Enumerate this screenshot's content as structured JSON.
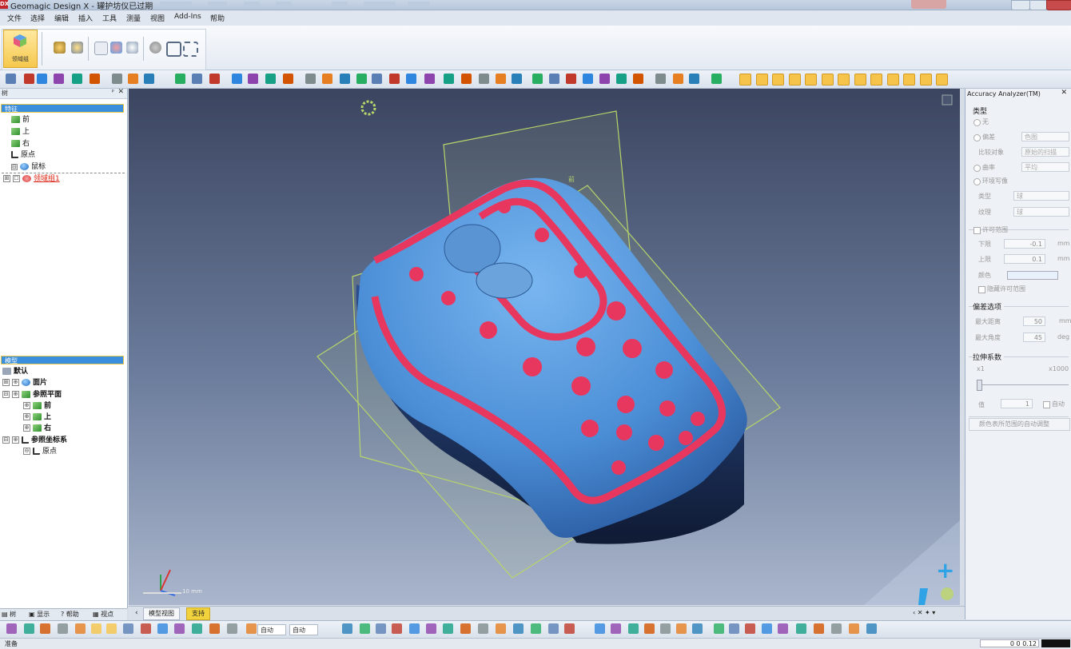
{
  "titlebar": {
    "app_name": "Geomagic Design X - 罐护坊仪已过期",
    "app_icon": "DX"
  },
  "menu": [
    "文件",
    "选择",
    "编辑",
    "插入",
    "工具",
    "测量",
    "视图",
    "Add-Ins",
    "帮助"
  ],
  "ribbon": {
    "region_group_label": "领域组"
  },
  "feature_tree": {
    "panel_title": "树",
    "header": "特征",
    "items": [
      {
        "label": "前",
        "icon": "plane-icon"
      },
      {
        "label": "上",
        "icon": "plane-icon"
      },
      {
        "label": "右",
        "icon": "plane-icon"
      },
      {
        "label": "原点",
        "icon": "axis-icon"
      },
      {
        "label": "鼠标",
        "icon": "mesh-icon"
      },
      {
        "label": "领域组1",
        "icon": "region-group-icon"
      }
    ]
  },
  "model_tree": {
    "header": "模型",
    "items": [
      {
        "label": "默认"
      },
      {
        "label": "面片"
      },
      {
        "label": "参照平面"
      },
      {
        "label": "前"
      },
      {
        "label": "上"
      },
      {
        "label": "右"
      },
      {
        "label": "参照坐标系"
      },
      {
        "label": "原点"
      }
    ]
  },
  "panel_tabs": [
    "树",
    "显示",
    "帮助",
    "视点"
  ],
  "viewport": {
    "plane_label": "前",
    "scale_label": "10 mm",
    "colors": {
      "mesh": "#4d8fd6",
      "band": "#e8375f",
      "plane": "#b8d56a"
    }
  },
  "accuracy_analyzer": {
    "title": "Accuracy Analyzer(TM)",
    "type_section": "类型",
    "opt_none": "无",
    "opt_deviation": "偏差",
    "deviation_value": "色图",
    "compare_label": "比较对象",
    "compare_value": "原始的扫描",
    "opt_curvature": "曲率",
    "curvature_value": "平均",
    "opt_env": "环境写像",
    "kind_label": "类型",
    "kind_value": "球",
    "texture_label": "纹理",
    "texture_value": "球",
    "tolerance_section": "许可范围",
    "lower_label": "下限",
    "lower_value": "-0.1",
    "upper_label": "上限",
    "upper_value": "0.1",
    "unit_mm": "mm",
    "color_label": "颜色",
    "hide_tolerance": "隐藏许可范围",
    "deviation_options": "偏差选项",
    "max_dist_label": "最大距离",
    "max_dist_value": "50",
    "max_angle_label": "最大角度",
    "max_angle_value": "45",
    "unit_deg": "deg",
    "stretch_section": "拉伸系数",
    "x1": "x1",
    "x1000": "x1000",
    "value_label": "值",
    "value_value": "1",
    "auto_label": "自动",
    "auto_adjust": "颜色表所范围的自动调整"
  },
  "view_tabs": [
    "模型视图",
    "支持"
  ],
  "bottom_toolbar": {
    "combo1": "自动",
    "combo2": "自动"
  },
  "status": {
    "text": "准备",
    "coords": "0 0 0.12"
  }
}
